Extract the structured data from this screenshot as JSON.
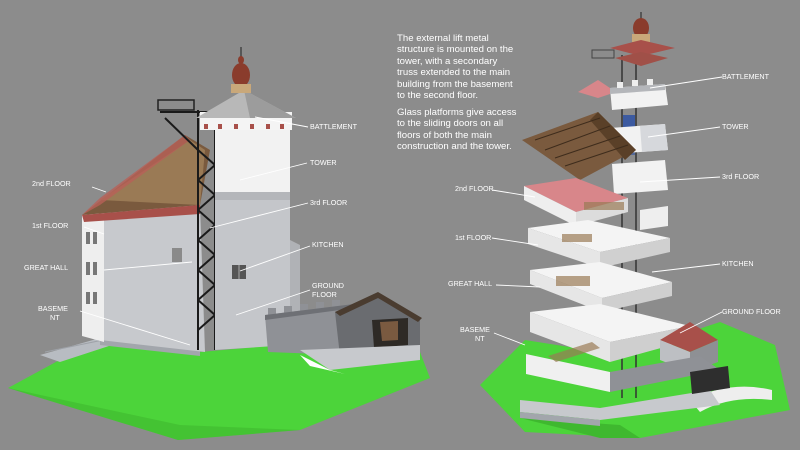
{
  "description": {
    "paragraph1": "The external lift metal structure is mounted on the tower, with a secondary truss extended to the main building from the basement to the second floor.",
    "paragraph2": "Glass platforms give access to the sliding doors on all floors of both the main construction and the tower."
  },
  "left_labels": {
    "battlement": "BATTLEMENT",
    "tower": "TOWER",
    "third_floor": "3rd FLOOR",
    "kitchen": "KITCHEN",
    "ground_floor_1": "GROUND",
    "ground_floor_2": "FLOOR",
    "second_floor": "2nd FLOOR",
    "first_floor": "1st FLOOR",
    "great_hall": "GREAT HALL",
    "basement_1": "BASEME",
    "basement_2": "NT"
  },
  "right_labels": {
    "battlement": "BATTLEMENT",
    "tower": "TOWER",
    "third_floor": "3rd FLOOR",
    "kitchen": "KITCHEN",
    "ground_floor": "GROUND FLOOR",
    "second_floor": "2nd FLOOR",
    "first_floor": "1st FLOOR",
    "great_hall": "GREAT HALL",
    "basement_1": "BASEME",
    "basement_2": "NT"
  },
  "colors": {
    "background": "#8c8c8c",
    "grass": "#4cd43a",
    "roof_tiles": "#a8504a",
    "roof_pink": "#d8868a",
    "wall_white": "#f2f2f2",
    "wall_grey": "#c4c6ca",
    "scaffold": "#1a1a1a",
    "leader_line": "#ffffff"
  }
}
